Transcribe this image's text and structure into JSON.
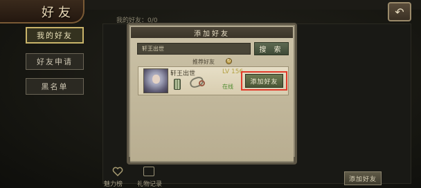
{
  "header": {
    "title": "好友",
    "back_icon": "back-arrow-icon"
  },
  "main": {
    "friend_count_label": "我的好友：0/0"
  },
  "sidebar": {
    "items": [
      {
        "label": "我的好友",
        "active": true
      },
      {
        "label": "好友申请",
        "active": false
      },
      {
        "label": "黑名单",
        "active": false
      }
    ]
  },
  "dialog": {
    "title": "添加好友",
    "search": {
      "value": "轩王出世",
      "button_label": "搜 索"
    },
    "recommend_label": "推荐好友",
    "recommendation": {
      "name": "轩王出世",
      "level": "LV 156",
      "status": "在线",
      "add_button_label": "添加好友"
    }
  },
  "bottom": {
    "charm_label": "魅力榜",
    "gift_label": "礼物记录",
    "add_button_label": "添加好友"
  },
  "colors": {
    "highlight": "#e23a2a",
    "online": "#4b8a2c",
    "level": "#b3a040"
  }
}
